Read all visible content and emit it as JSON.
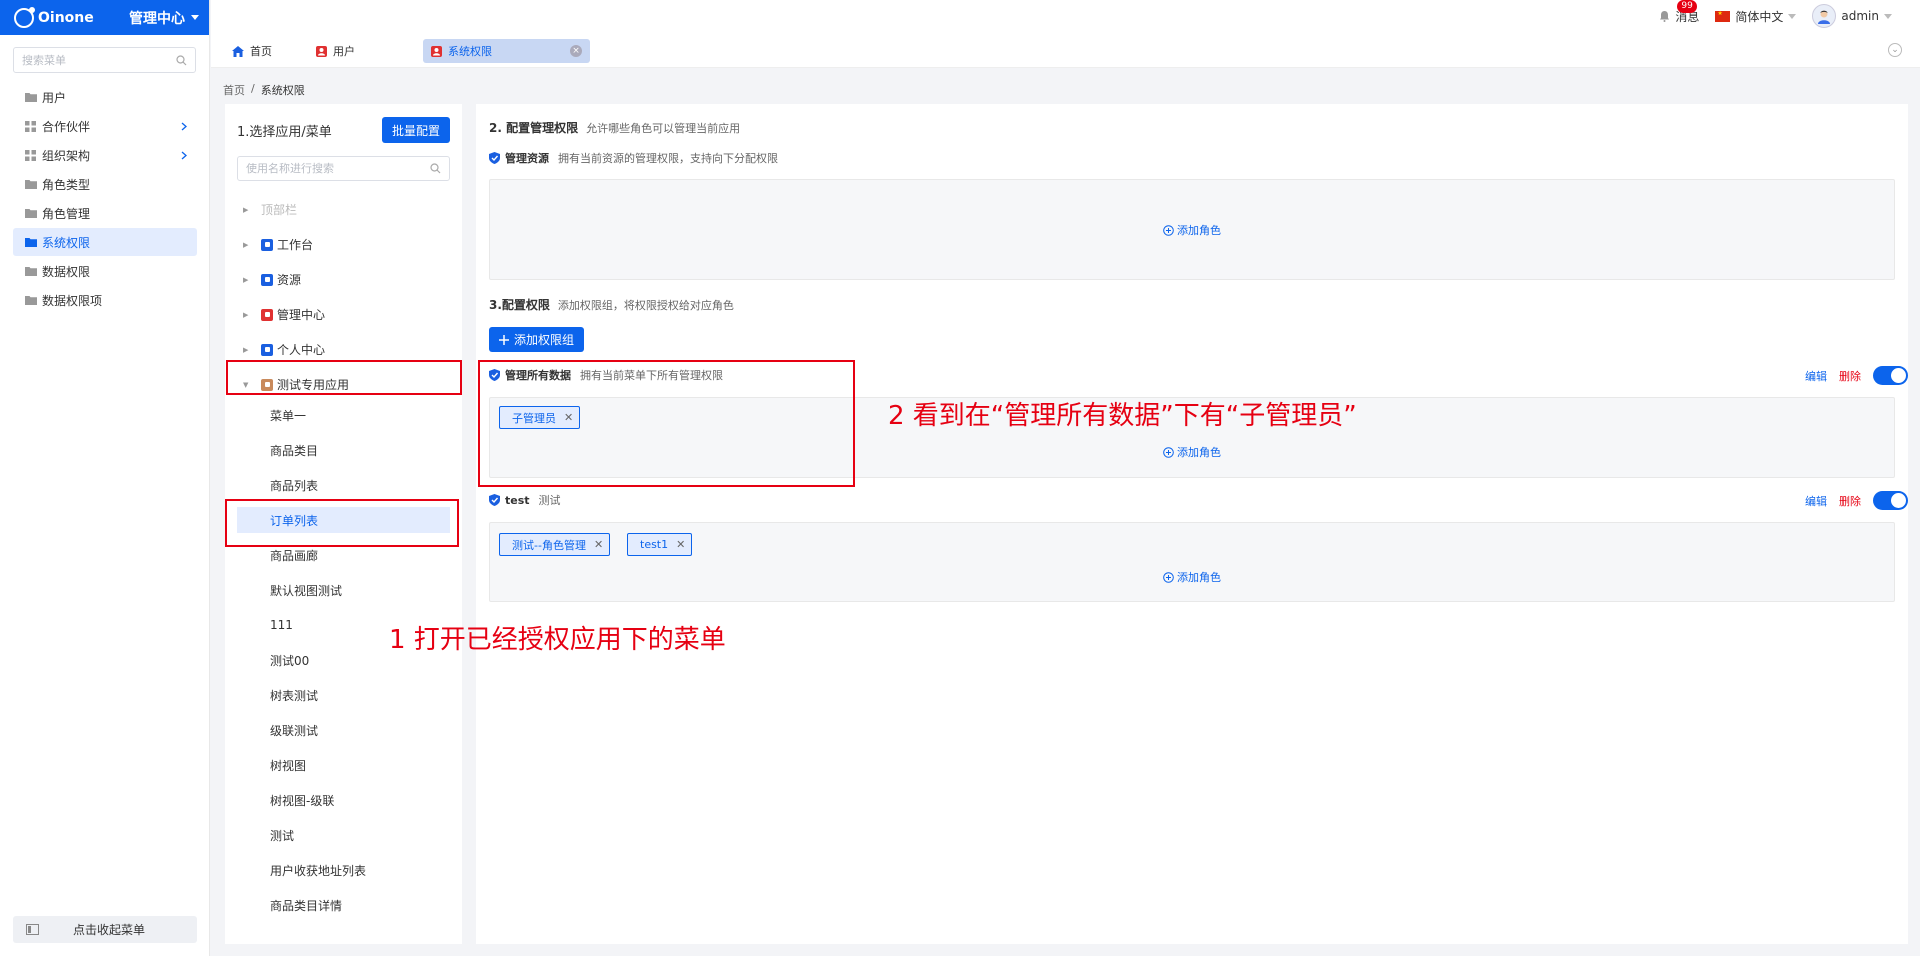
{
  "app": {
    "logo_text": "Oinone",
    "app_switch_label": "管理中心"
  },
  "sidebar": {
    "search_placeholder": "搜索菜单",
    "items": [
      {
        "label": "用户",
        "icon": "folder-icon",
        "has_children": false,
        "active": false
      },
      {
        "label": "合作伙伴",
        "icon": "grid-icon",
        "has_children": true,
        "active": false
      },
      {
        "label": "组织架构",
        "icon": "grid-icon",
        "has_children": true,
        "active": false
      },
      {
        "label": "角色类型",
        "icon": "folder-icon",
        "has_children": false,
        "active": false
      },
      {
        "label": "角色管理",
        "icon": "folder-icon",
        "has_children": false,
        "active": false
      },
      {
        "label": "系统权限",
        "icon": "folder-icon",
        "has_children": false,
        "active": true
      },
      {
        "label": "数据权限",
        "icon": "folder-icon",
        "has_children": false,
        "active": false
      },
      {
        "label": "数据权限项",
        "icon": "folder-icon",
        "has_children": false,
        "active": false
      }
    ],
    "collapse_label": "点击收起菜单"
  },
  "topbar": {
    "messages_label": "消息",
    "messages_badge": "99",
    "language_label": "简体中文",
    "user_name": "admin"
  },
  "tabs": [
    {
      "label": "首页",
      "icon": "home-icon",
      "active": false
    },
    {
      "label": "用户",
      "icon": "user-icon",
      "active": false
    },
    {
      "label": "系统权限",
      "icon": "user-icon",
      "active": true
    }
  ],
  "breadcrumb": {
    "root": "首页",
    "separator": "/",
    "current": "系统权限"
  },
  "left_panel": {
    "title": "1.选择应用/菜单",
    "batch_button": "批量配置",
    "search_placeholder": "使用名称进行搜索",
    "nodes": [
      {
        "label": "顶部栏",
        "disabled": true,
        "icon_color": ""
      },
      {
        "label": "工作台",
        "disabled": false,
        "icon_color": "#1a5fe0"
      },
      {
        "label": "资源",
        "disabled": false,
        "icon_color": "#1a5fe0"
      },
      {
        "label": "管理中心",
        "disabled": false,
        "icon_color": "#e03131"
      },
      {
        "label": "个人中心",
        "disabled": false,
        "icon_color": "#1a5fe0"
      },
      {
        "label": "测试专用应用",
        "disabled": false,
        "expanded": true,
        "icon_color": "#c98a5c"
      }
    ],
    "leaves": [
      "菜单一",
      "商品类目",
      "商品列表",
      "订单列表",
      "商品画廊",
      "默认视图测试",
      "111",
      "测试00",
      "树表测试",
      "级联测试",
      "树视图",
      "树视图-级联",
      "测试",
      "用户收获地址列表",
      "商品类目详情"
    ],
    "active_leaf": "订单列表"
  },
  "right_panel": {
    "section2": {
      "title": "2. 配置管理权限",
      "desc": "允许哪些角色可以管理当前应用",
      "sub_title": "管理资源",
      "sub_desc": "拥有当前资源的管理权限，支持向下分配权限",
      "add_role": "添加角色"
    },
    "section3": {
      "title": "3.配置权限",
      "desc": "添加权限组，将权限授权给对应角色",
      "add_group_button": "添加权限组"
    },
    "groups": [
      {
        "title": "管理所有数据",
        "desc": "拥有当前菜单下所有管理权限",
        "edit": "编辑",
        "delete": "删除",
        "enabled": true,
        "roles": [
          "子管理员"
        ],
        "add_role": "添加角色"
      },
      {
        "title": "test",
        "desc": "测试",
        "edit": "编辑",
        "delete": "删除",
        "enabled": true,
        "roles": [
          "测试--角色管理",
          "test1"
        ],
        "add_role": "添加角色"
      }
    ]
  },
  "annotations": {
    "note1": "1 打开已经授权应用下的菜单",
    "note2": "2 看到在“管理所有数据”下有“子管理员”",
    "color": "#e60012"
  }
}
